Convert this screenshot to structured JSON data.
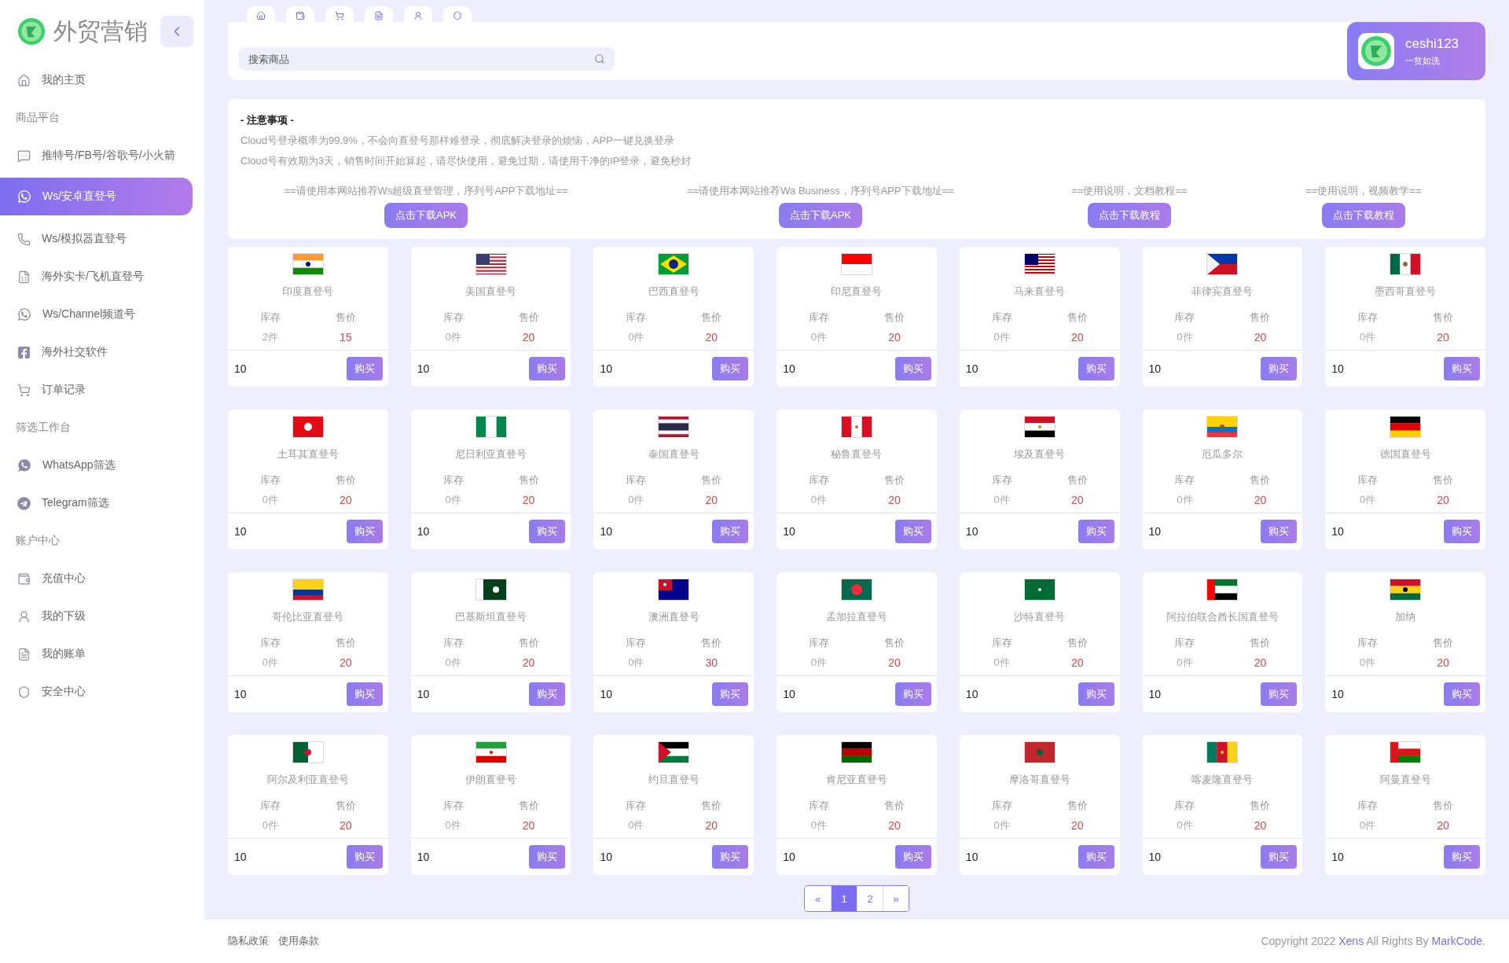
{
  "brand": {
    "name": "外贸营销"
  },
  "sidebar": {
    "items": [
      {
        "kind": "link",
        "label": "我的主页",
        "selected": false
      },
      {
        "kind": "section",
        "label": "商品平台"
      },
      {
        "kind": "link",
        "label": "推特号/FB号/谷歌号/小火箭",
        "selected": false
      },
      {
        "kind": "link",
        "label": "Ws/安卓直登号",
        "selected": true
      },
      {
        "kind": "link",
        "label": "Ws/模拟器直登号",
        "selected": false
      },
      {
        "kind": "link",
        "label": "海外实卡/飞机直登号",
        "selected": false
      },
      {
        "kind": "link",
        "label": "Ws/Channel频道号",
        "selected": false
      },
      {
        "kind": "link",
        "label": "海外社交软件",
        "selected": false
      },
      {
        "kind": "link",
        "label": "订单记录",
        "selected": false
      },
      {
        "kind": "section",
        "label": "筛选工作台"
      },
      {
        "kind": "link",
        "label": "WhatsApp筛选",
        "selected": false
      },
      {
        "kind": "link",
        "label": "Telegram筛选",
        "selected": false
      },
      {
        "kind": "section",
        "label": "账户中心"
      },
      {
        "kind": "link",
        "label": "充值中心",
        "selected": false
      },
      {
        "kind": "link",
        "label": "我的下级",
        "selected": false
      },
      {
        "kind": "link",
        "label": "我的账单",
        "selected": false
      },
      {
        "kind": "link",
        "label": "安全中心",
        "selected": false
      }
    ]
  },
  "topbar": {
    "search": {
      "placeholder": "搜索商品"
    },
    "user": {
      "name": "ceshi123",
      "status": "一贫如洗"
    }
  },
  "notice": {
    "title": "- 注意事项 -",
    "lines": [
      "Cloud号登录概率为99.9%，不会向直登号那样难登录，彻底解决登录的烦恼，APP一键兑换登录",
      "Cloud号有效期为3天，销售时间开始算起，请尽快使用，避免过期，请使用干净的IP登录，避免秒封"
    ],
    "downloads": [
      {
        "caption": "==请使用本网站推荐Ws超级直登管理，序列号APP下载地址==",
        "button": "点击下载APK"
      },
      {
        "caption": "==请使用本网站推荐Wa Business，序列号APP下载地址==",
        "button": "点击下载APK"
      },
      {
        "caption": "==使用说明，文档教程==",
        "button": "点击下载教程"
      },
      {
        "caption": "==使用说明，视频教学==",
        "button": "点击下载教程"
      }
    ]
  },
  "products": [
    {
      "name": "印度直登号",
      "stock_label": "库存",
      "price_label": "售价",
      "stock": "2件",
      "price": "15",
      "quantity": "10",
      "buy": "购买"
    },
    {
      "name": "美国直登号",
      "stock_label": "库存",
      "price_label": "售价",
      "stock": "0件",
      "price": "20",
      "quantity": "10",
      "buy": "购买"
    },
    {
      "name": "巴西直登号",
      "stock_label": "库存",
      "price_label": "售价",
      "stock": "0件",
      "price": "20",
      "quantity": "10",
      "buy": "购买"
    },
    {
      "name": "印尼直登号",
      "stock_label": "库存",
      "price_label": "售价",
      "stock": "0件",
      "price": "20",
      "quantity": "10",
      "buy": "购买"
    },
    {
      "name": "马来直登号",
      "stock_label": "库存",
      "price_label": "售价",
      "stock": "0件",
      "price": "20",
      "quantity": "10",
      "buy": "购买"
    },
    {
      "name": "菲律宾直登号",
      "stock_label": "库存",
      "price_label": "售价",
      "stock": "0件",
      "price": "20",
      "quantity": "10",
      "buy": "购买"
    },
    {
      "name": "墨西哥直登号",
      "stock_label": "库存",
      "price_label": "售价",
      "stock": "0件",
      "price": "20",
      "quantity": "10",
      "buy": "购买"
    },
    {
      "name": "土耳其直登号",
      "stock_label": "库存",
      "price_label": "售价",
      "stock": "0件",
      "price": "20",
      "quantity": "10",
      "buy": "购买"
    },
    {
      "name": "尼日利亚直登号",
      "stock_label": "库存",
      "price_label": "售价",
      "stock": "0件",
      "price": "20",
      "quantity": "10",
      "buy": "购买"
    },
    {
      "name": "泰国直登号",
      "stock_label": "库存",
      "price_label": "售价",
      "stock": "0件",
      "price": "20",
      "quantity": "10",
      "buy": "购买"
    },
    {
      "name": "秘鲁直登号",
      "stock_label": "库存",
      "price_label": "售价",
      "stock": "0件",
      "price": "20",
      "quantity": "10",
      "buy": "购买"
    },
    {
      "name": "埃及直登号",
      "stock_label": "库存",
      "price_label": "售价",
      "stock": "0件",
      "price": "20",
      "quantity": "10",
      "buy": "购买"
    },
    {
      "name": "厄瓜多尔",
      "stock_label": "库存",
      "price_label": "售价",
      "stock": "0件",
      "price": "20",
      "quantity": "10",
      "buy": "购买"
    },
    {
      "name": "德国直登号",
      "stock_label": "库存",
      "price_label": "售价",
      "stock": "0件",
      "price": "20",
      "quantity": "10",
      "buy": "购买"
    },
    {
      "name": "哥伦比亚直登号",
      "stock_label": "库存",
      "price_label": "售价",
      "stock": "0件",
      "price": "20",
      "quantity": "10",
      "buy": "购买"
    },
    {
      "name": "巴基斯坦直登号",
      "stock_label": "库存",
      "price_label": "售价",
      "stock": "0件",
      "price": "20",
      "quantity": "10",
      "buy": "购买"
    },
    {
      "name": "澳洲直登号",
      "stock_label": "库存",
      "price_label": "售价",
      "stock": "0件",
      "price": "30",
      "quantity": "10",
      "buy": "购买"
    },
    {
      "name": "孟加拉直登号",
      "stock_label": "库存",
      "price_label": "售价",
      "stock": "0件",
      "price": "20",
      "quantity": "10",
      "buy": "购买"
    },
    {
      "name": "沙特直登号",
      "stock_label": "库存",
      "price_label": "售价",
      "stock": "0件",
      "price": "20",
      "quantity": "10",
      "buy": "购买"
    },
    {
      "name": "阿拉伯联合酋长国直登号",
      "stock_label": "库存",
      "price_label": "售价",
      "stock": "0件",
      "price": "20",
      "quantity": "10",
      "buy": "购买"
    },
    {
      "name": "加纳",
      "stock_label": "库存",
      "price_label": "售价",
      "stock": "0件",
      "price": "20",
      "quantity": "10",
      "buy": "购买"
    },
    {
      "name": "阿尔及利亚直登号",
      "stock_label": "库存",
      "price_label": "售价",
      "stock": "0件",
      "price": "20",
      "quantity": "10",
      "buy": "购买"
    },
    {
      "name": "伊朗直登号",
      "stock_label": "库存",
      "price_label": "售价",
      "stock": "0件",
      "price": "20",
      "quantity": "10",
      "buy": "购买"
    },
    {
      "name": "约旦直登号",
      "stock_label": "库存",
      "price_label": "售价",
      "stock": "0件",
      "price": "20",
      "quantity": "10",
      "buy": "购买"
    },
    {
      "name": "肯尼亚直登号",
      "stock_label": "库存",
      "price_label": "售价",
      "stock": "0件",
      "price": "20",
      "quantity": "10",
      "buy": "购买"
    },
    {
      "name": "摩洛哥直登号",
      "stock_label": "库存",
      "price_label": "售价",
      "stock": "0件",
      "price": "20",
      "quantity": "10",
      "buy": "购买"
    },
    {
      "name": "喀麦隆直登号",
      "stock_label": "库存",
      "price_label": "售价",
      "stock": "0件",
      "price": "20",
      "quantity": "10",
      "buy": "购买"
    },
    {
      "name": "阿曼直登号",
      "stock_label": "库存",
      "price_label": "售价",
      "stock": "0件",
      "price": "20",
      "quantity": "10",
      "buy": "购买"
    }
  ],
  "pagination": [
    {
      "label": "«",
      "selected": false
    },
    {
      "label": "1",
      "selected": true
    },
    {
      "label": "2",
      "selected": false
    },
    {
      "label": "»",
      "selected": false
    }
  ],
  "footer": {
    "links": [
      "隐私政策",
      "使用条款"
    ],
    "copyright": {
      "before": "Copyright 2022",
      "author": "Xens",
      "middle": "All Rights By",
      "maker": "MarkCode",
      "after": "."
    }
  }
}
